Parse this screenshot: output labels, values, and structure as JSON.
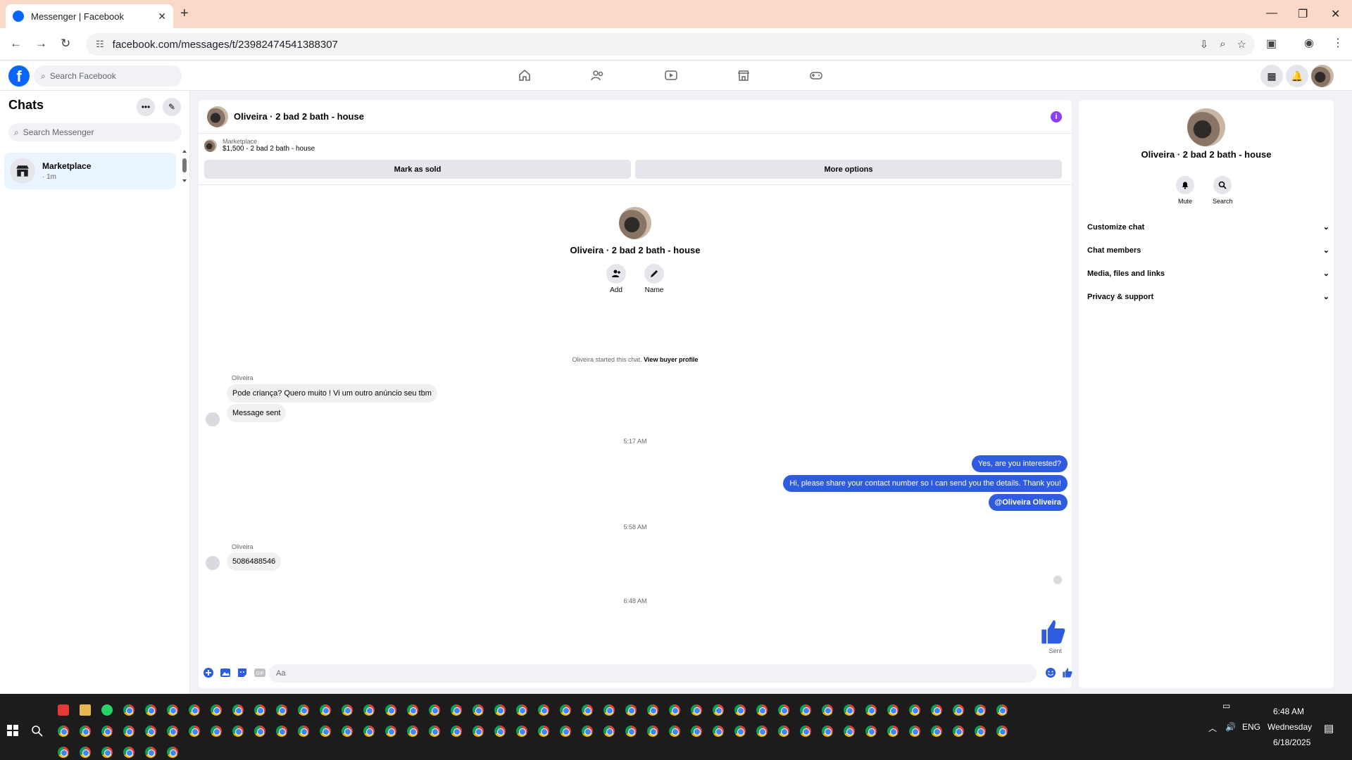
{
  "browser": {
    "tab_title": "Messenger | Facebook",
    "url": "facebook.com/messages/t/23982474541388307"
  },
  "fb": {
    "search_placeholder": "Search Facebook"
  },
  "chats": {
    "title": "Chats",
    "search_placeholder": "Search Messenger",
    "items": [
      {
        "name": "Marketplace",
        "time": "· 1m"
      }
    ]
  },
  "conversation": {
    "title": "Oliveira · 2 bad 2 bath - house",
    "marketplace_label": "Marketplace",
    "listing": "$1,500 - 2 bad 2 bath - house",
    "mark_sold": "Mark as sold",
    "more_options": "More options",
    "profile_name": "Oliveira · 2 bad 2 bath - house",
    "add_label": "Add",
    "name_label": "Name",
    "system_message": "Oliveira started this chat.",
    "view_buyer_profile": "View buyer profile",
    "messages": {
      "sender1": "Oliveira",
      "in1": "Pode criança? Quero muito ! Vi um outro anúncio seu tbm",
      "in2": "Message sent",
      "time1": "5:17 AM",
      "out1": "Yes, are you interested?",
      "out2": "Hi, please share your contact number so I can send you the details. Thank you!",
      "out3": "@Oliveira Oliveira",
      "time2": "5:58 AM",
      "sender2": "Oliveira",
      "in3": "5086488546",
      "time3": "6:48 AM",
      "sent_label": "Sent"
    },
    "composer_placeholder": "Aa"
  },
  "details": {
    "name": "Oliveira · 2 bad 2 bath - house",
    "mute": "Mute",
    "search": "Search",
    "sections": [
      "Customize chat",
      "Chat members",
      "Media, files and links",
      "Privacy & support"
    ]
  },
  "taskbar": {
    "time": "6:48 AM",
    "day": "Wednesday",
    "date": "6/18/2025",
    "lang": "ENG"
  },
  "colors": {
    "accent": "#2e5be0",
    "fb_blue": "#0866ff",
    "tab_bar": "#fbd9c8"
  }
}
